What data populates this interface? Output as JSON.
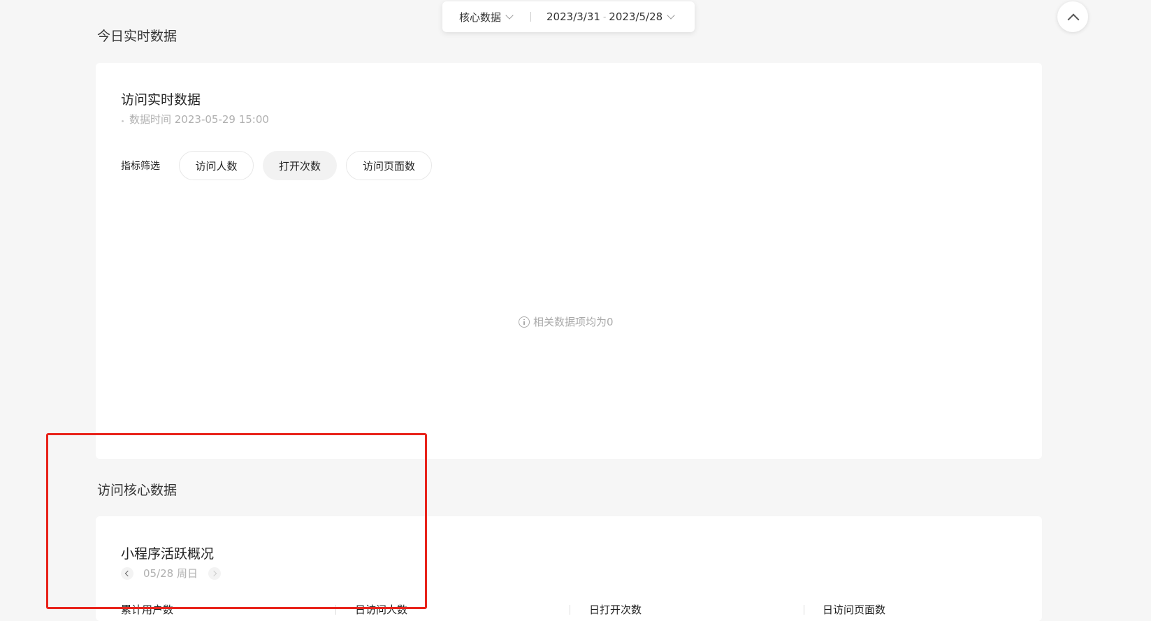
{
  "topbar": {
    "category": "核心数据",
    "date_start": "2023/3/31",
    "date_sep": "-",
    "date_end": "2023/5/28"
  },
  "sections": {
    "realtime_title": "今日实时数据",
    "core_title": "访问核心数据"
  },
  "realtime_card": {
    "title": "访问实时数据",
    "data_time": "数据时间 2023-05-29 15:00",
    "filter_label": "指标筛选",
    "filters": [
      "访问人数",
      "打开次数",
      "访问页面数"
    ],
    "selected_filter": "打开次数",
    "empty_message": "相关数据项均为0"
  },
  "active_card": {
    "title": "小程序活跃概况",
    "date": "05/28 周日",
    "metrics": [
      "累计用户数",
      "日访问人数",
      "日打开次数",
      "日访问页面数"
    ]
  },
  "icons": [
    "chevron-down-icon",
    "chevron-up-icon",
    "info-icon",
    "chevron-left-icon",
    "chevron-right-icon"
  ],
  "colors": {
    "highlight": "#e8231b",
    "background": "#f6f6f6"
  }
}
